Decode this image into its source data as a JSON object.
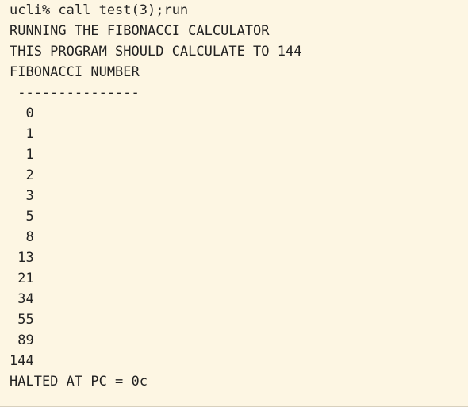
{
  "terminal": {
    "command": "ucli% call test(3);run",
    "banner": [
      "RUNNING THE FIBONACCI CALCULATOR",
      "THIS PROGRAM SHOULD CALCULATE TO 144",
      "FIBONACCI NUMBER",
      " ---------------"
    ],
    "values": [
      "  0",
      "  1",
      "  1",
      "  2",
      "  3",
      "  5",
      "  8",
      " 13",
      " 21",
      " 34",
      " 55",
      " 89",
      "144"
    ],
    "final": "HALTED AT PC = 0c"
  }
}
